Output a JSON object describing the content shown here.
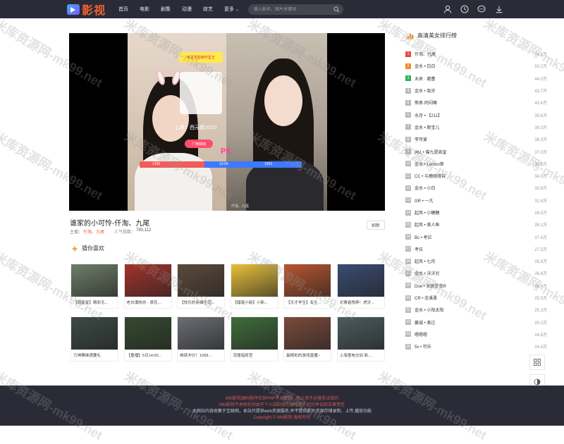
{
  "header": {
    "logo_text": "影视",
    "nav": [
      "首页",
      "电影",
      "剧集",
      "动漫",
      "综艺",
      "更多"
    ],
    "search_placeholder": "输入影名、图片关键词",
    "bg_color": "#2b2b38",
    "accent": "#f0642d",
    "icons": [
      "user-icon",
      "history-icon",
      "message-icon",
      "download-icon"
    ]
  },
  "player": {
    "pk_card_text": "恭喜雪碧荣升星王",
    "topic_text": "心愿：西元僧16/20",
    "gift_button": "广西妹妹",
    "pk_text": "PK",
    "left_score": "1345",
    "right_score": "1550",
    "timer": "13:54",
    "left_label": "心愿",
    "right_label": "仟淘、九尾"
  },
  "video": {
    "title": "谁家的小可怜-仟淘、九尾",
    "host_label": "主播：",
    "host_value": "仟淘、九尾",
    "popularity_label": "人气指数：",
    "popularity_value": "780,112",
    "follow_label": "刷新"
  },
  "guess": {
    "title": "猜你喜欢",
    "cards": [
      {
        "caption": "【周星星】精彩无...",
        "color": "#6e7e6a"
      },
      {
        "caption": "老白潮肉坊 - 梁花...",
        "color": "#a4322b"
      },
      {
        "caption": "【快乐的英雄生活...",
        "color": "#5c4a3a"
      },
      {
        "caption": "【蜡笔小新】小新...",
        "color": "#e8c13a"
      },
      {
        "caption": "【天才学生】有生...",
        "color": "#b8552f"
      },
      {
        "caption": "无情者残莽！虎牙...",
        "color": "#3a4c72"
      },
      {
        "caption": "万神赛继透要礼",
        "color": "#3d4a44"
      },
      {
        "caption": "【重播】5日14:00...",
        "color": "#344b2f"
      },
      {
        "caption": "继续冲分！1068...",
        "color": "#6b6e74"
      },
      {
        "caption": "克隆指挥官",
        "color": "#3f6d3a"
      },
      {
        "caption": "最精彩的游戏直播~",
        "color": "#7b4b3a"
      },
      {
        "caption": "上海萤电交加 新...",
        "color": "#4b5c60"
      }
    ]
  },
  "ranking": {
    "title": "高清美女排行榜",
    "items": [
      {
        "rank": "1",
        "name": "仟淘、九尾",
        "count": "74.8万"
      },
      {
        "rank": "2",
        "name": "金水 • 白白",
        "count": "53.2万"
      },
      {
        "rank": "3",
        "name": "未来 · 葩蕾",
        "count": "44.0万"
      },
      {
        "rank": "4",
        "name": "金水 • 兔牙",
        "count": "43.7万"
      },
      {
        "rank": "5",
        "name": "熊男·阿闷嘛",
        "count": "43.4万"
      },
      {
        "rank": "6",
        "name": "水月 • 【211】",
        "count": "39.6万"
      },
      {
        "rank": "7",
        "name": "金水 • 颜宝儿",
        "count": "39.3万"
      },
      {
        "rank": "8",
        "name": "李可爱",
        "count": "38.3万"
      },
      {
        "rank": "9",
        "name": "961 • 猫九是欲皇",
        "count": "37.0万"
      },
      {
        "rank": "10",
        "name": "金水 • Lemon茶",
        "count": "35.6万"
      },
      {
        "rank": "11",
        "name": "CC • 与鹿随缘自",
        "count": "34.0万"
      },
      {
        "rank": "12",
        "name": "金水 • 小白",
        "count": "33.9万"
      },
      {
        "rank": "13",
        "name": "GR • 一凡",
        "count": "31.6万"
      },
      {
        "rank": "14",
        "name": "起风 • 小糖糖",
        "count": "28.5万"
      },
      {
        "rank": "15",
        "name": "起风 • 美人鱼",
        "count": "28.1万"
      },
      {
        "rank": "16",
        "name": "Bc • 考拉",
        "count": "27.4万"
      },
      {
        "rank": "17",
        "name": "考拉",
        "count": "27.3万"
      },
      {
        "rank": "18",
        "name": "起风 • 七月",
        "count": "26.6万"
      },
      {
        "rank": "19",
        "name": "金水 • 沃沃兒",
        "count": "26.6万"
      },
      {
        "rank": "20",
        "name": "Doe • 安妮是我R",
        "count": "26.4万"
      },
      {
        "rank": "21",
        "name": "CR • 念溪柔",
        "count": "25.5万"
      },
      {
        "rank": "22",
        "name": "金水 • 小阳太阳",
        "count": "25.3万"
      },
      {
        "rank": "23",
        "name": "赢城 • 美过",
        "count": "25.0万"
      },
      {
        "rank": "24",
        "name": "嗯嗯嗯",
        "count": "24.6万"
      },
      {
        "rank": "25",
        "name": "5x • 可乐",
        "count": "24.6万"
      }
    ],
    "top_colors": [
      "#e84a3c",
      "#f18c2b",
      "#2eb25b"
    ]
  },
  "float_tools": [
    "grid-icon",
    "theme-icon",
    "chat-icon"
  ],
  "footer": {
    "line1": "MM影院源码程序仅供PHP学习使用，禁止用于运营非法目的",
    "line2": "MM影院不承担任何由于个人因因侵犯版权而引起的争议和法律责任",
    "line3": "本网站内容收集于互联网，本站只提供web资源服务,并不提供影片资源存储录制、上传,播放功能",
    "line4": "Copyright © MM影院 版权所有"
  },
  "watermark": "米库资源网-mk99.net"
}
